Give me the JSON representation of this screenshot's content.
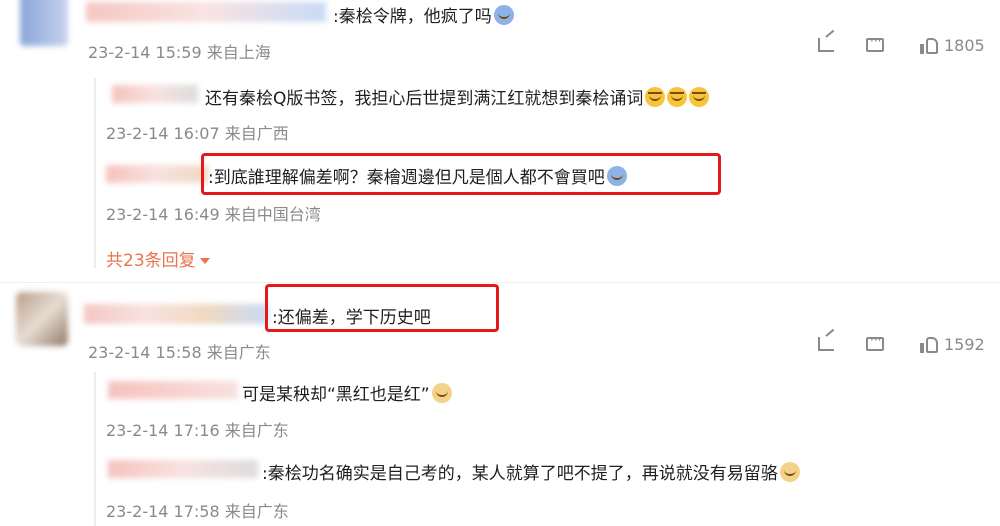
{
  "comment1": {
    "text": ":秦桧令牌，他疯了吗",
    "meta": "23-2-14 15:59 来自上海",
    "likes": "1805",
    "replies": [
      {
        "text": "还有秦桧Q版书签，我担心后世提到满江红就想到秦桧诵词",
        "meta": "23-2-14 16:07 来自广西"
      },
      {
        "text": ":到底誰理解偏差啊？秦檜週邊但凡是個人都不會買吧",
        "meta": "23-2-14 16:49 来自中国台湾"
      }
    ],
    "more_replies": "共23条回复"
  },
  "comment2": {
    "text": ":还偏差，学下历史吧",
    "meta": "23-2-14 15:58 来自广东",
    "likes": "1592",
    "replies": [
      {
        "text": "可是某秧却“黑红也是红”",
        "meta": "23-2-14 17:16 来自广东"
      },
      {
        "text": ":秦桧功名确实是自己考的，某人就算了吧不提了，再说就没有易留骆",
        "meta": "23-2-14 17:58 来自广东"
      }
    ]
  },
  "colors": {
    "highlight_border": "#e3191b",
    "accent": "#eb7350",
    "meta_text": "#8a8a8a"
  },
  "icons": [
    "share-icon",
    "comment-icon",
    "like-icon",
    "caret-down-icon",
    "laugh-emoji",
    "dog-emoji"
  ]
}
